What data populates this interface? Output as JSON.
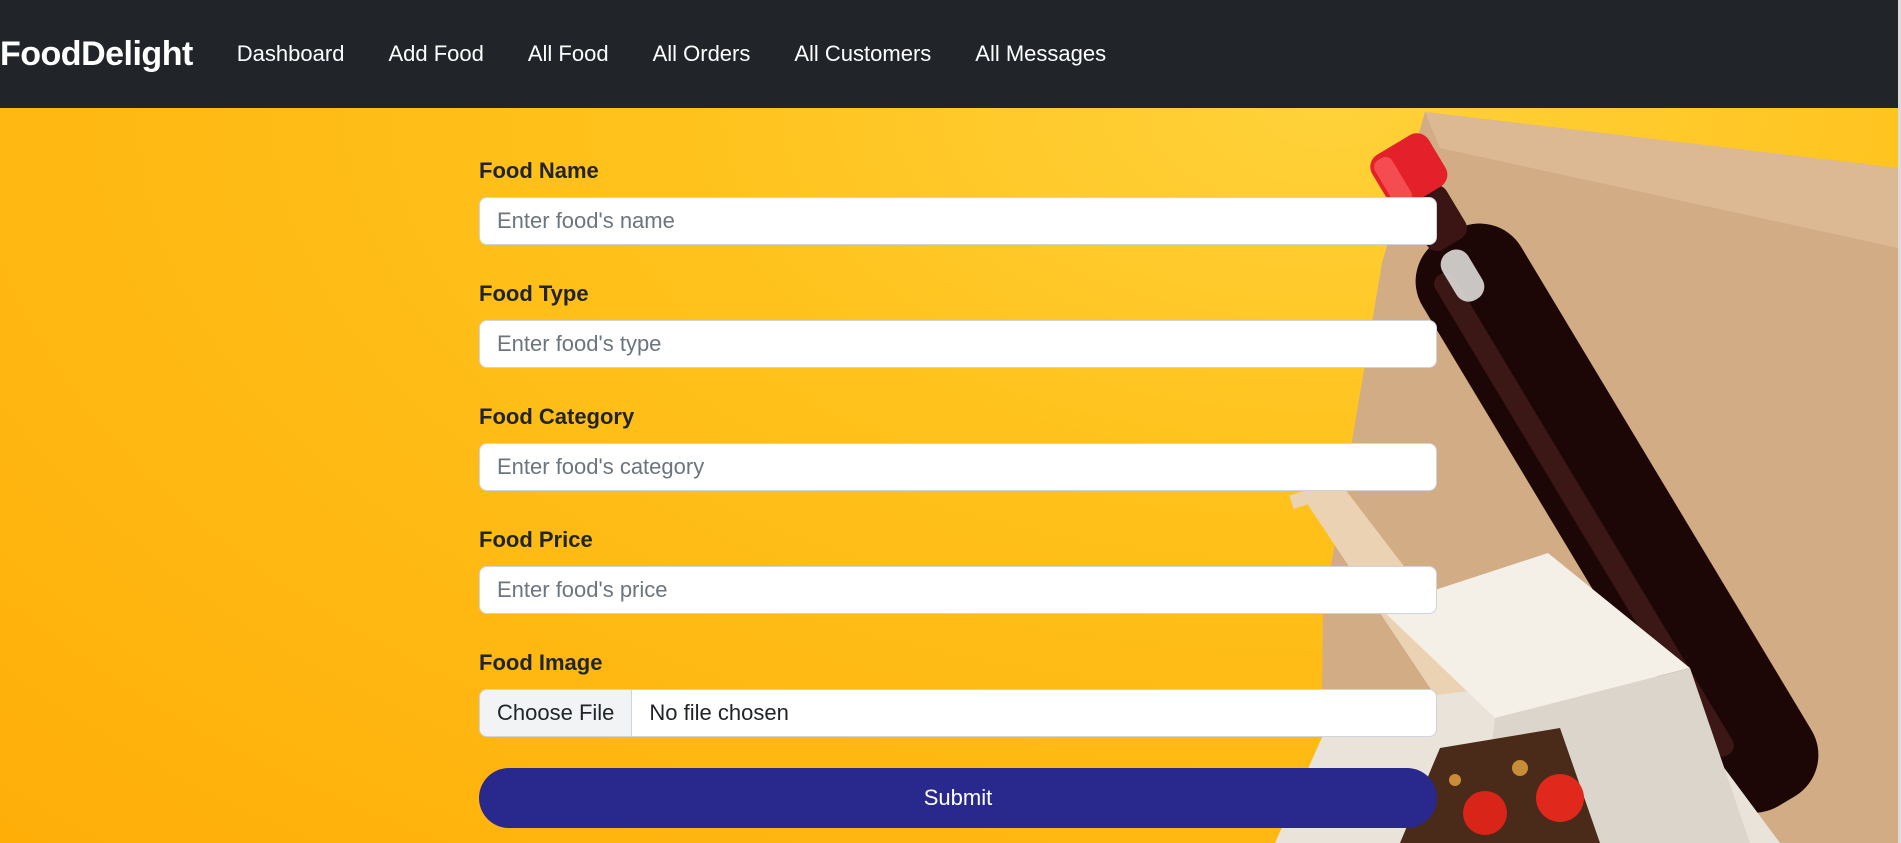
{
  "brand": "FoodDelight",
  "nav": {
    "items": [
      {
        "label": "Dashboard"
      },
      {
        "label": "Add Food"
      },
      {
        "label": "All Food"
      },
      {
        "label": "All Orders"
      },
      {
        "label": "All Customers"
      },
      {
        "label": "All Messages"
      }
    ]
  },
  "form": {
    "name": {
      "label": "Food Name",
      "placeholder": "Enter food's name"
    },
    "type": {
      "label": "Food Type",
      "placeholder": "Enter food's type"
    },
    "category": {
      "label": "Food Category",
      "placeholder": "Enter food's category"
    },
    "price": {
      "label": "Food Price",
      "placeholder": "Enter food's price"
    },
    "image": {
      "label": "Food Image",
      "button": "Choose File",
      "status": "No file chosen"
    },
    "submit_label": "Submit"
  },
  "colors": {
    "navbar": "#212529",
    "background": "#ffb000",
    "submit": "#29288c"
  }
}
